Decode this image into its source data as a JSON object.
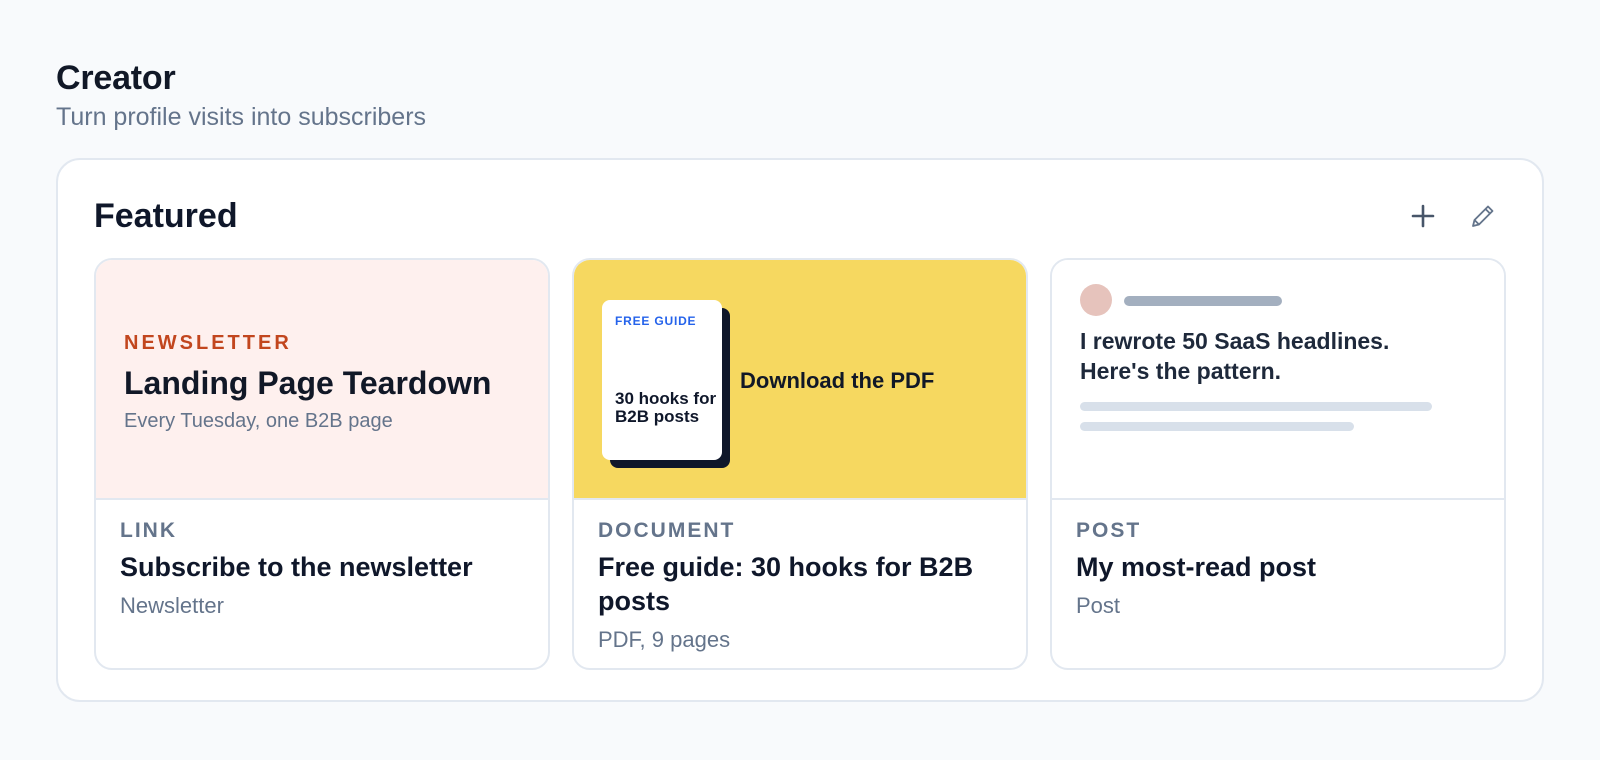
{
  "header": {
    "title": "Creator",
    "subtitle": "Turn profile visits into subscribers"
  },
  "featured": {
    "title": "Featured",
    "add_icon": "plus-icon",
    "edit_icon": "pencil-icon",
    "cards": [
      {
        "media": {
          "kicker": "NEWSLETTER",
          "title": "Landing Page Teardown",
          "subtitle": "Every Tuesday, one B2B page",
          "background": "#fef0ee",
          "accent": "#c2461e"
        },
        "type": "LINK",
        "title": "Subscribe to the newsletter",
        "meta": "Newsletter"
      },
      {
        "media": {
          "tag": "FREE GUIDE",
          "doc_title": "30 hooks for B2B posts",
          "cta": "Download the PDF",
          "background": "#f6d860",
          "accent": "#2563eb"
        },
        "type": "DOCUMENT",
        "title": "Free guide: 30 hooks for B2B posts",
        "meta": "PDF, 9 pages"
      },
      {
        "media": {
          "text": "I rewrote 50 SaaS headlines. Here's the pattern.",
          "avatar_color": "#e6c3bc"
        },
        "type": "POST",
        "title": "My most-read post",
        "meta": "Post"
      }
    ]
  }
}
